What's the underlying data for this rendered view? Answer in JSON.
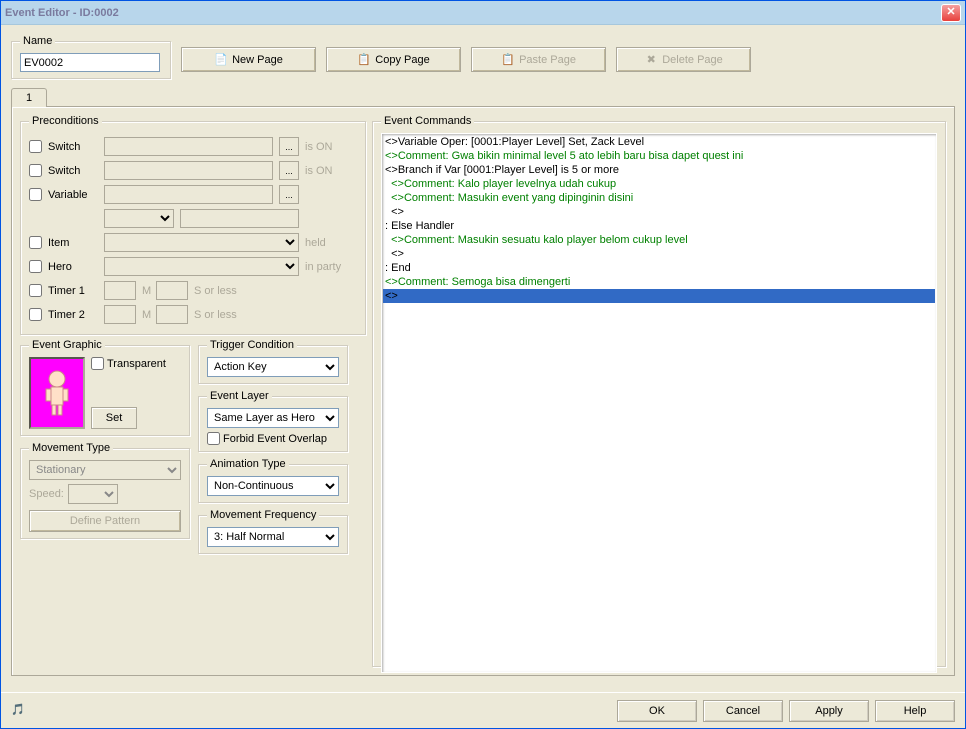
{
  "window": {
    "title": "Event Editor - ID:0002"
  },
  "name": {
    "label": "Name",
    "value": "EV0002"
  },
  "buttons": {
    "new_page": "New Page",
    "copy_page": "Copy Page",
    "paste_page": "Paste Page",
    "delete_page": "Delete Page",
    "ok": "OK",
    "cancel": "Cancel",
    "apply": "Apply",
    "help": "Help",
    "set": "Set"
  },
  "tabs": [
    {
      "label": "1"
    }
  ],
  "preconditions": {
    "legend": "Preconditions",
    "rows": [
      {
        "label": "Switch",
        "suffix": "is ON"
      },
      {
        "label": "Switch",
        "suffix": "is ON"
      },
      {
        "label": "Variable",
        "suffix": ""
      },
      {
        "label": "Item",
        "suffix": "held"
      },
      {
        "label": "Hero",
        "suffix": "in party"
      },
      {
        "label": "Timer 1",
        "suffix": "S or less"
      },
      {
        "label": "Timer 2",
        "suffix": "S or less"
      }
    ]
  },
  "event_graphic": {
    "legend": "Event Graphic",
    "transparent_label": "Transparent"
  },
  "trigger": {
    "legend": "Trigger Condition",
    "value": "Action Key"
  },
  "layer": {
    "legend": "Event Layer",
    "value": "Same Layer as Hero",
    "forbid_label": "Forbid Event Overlap"
  },
  "movement": {
    "legend": "Movement Type",
    "value": "Stationary",
    "speed_label": "Speed:",
    "define_label": "Define Pattern"
  },
  "animation": {
    "legend": "Animation Type",
    "value": "Non-Continuous"
  },
  "frequency": {
    "legend": "Movement Frequency",
    "value": "3: Half Normal"
  },
  "commands": {
    "legend": "Event Commands",
    "lines": [
      {
        "indent": 0,
        "color": "black",
        "text": "<>Variable Oper: [0001:Player Level] Set, Zack Level"
      },
      {
        "indent": 0,
        "color": "green",
        "text": "<>Comment: Gwa bikin minimal level 5 ato lebih baru bisa dapet quest ini"
      },
      {
        "indent": 0,
        "color": "black",
        "text": "<>Branch if Var [0001:Player Level] is 5 or more"
      },
      {
        "indent": 1,
        "color": "green",
        "text": "<>Comment: Kalo player levelnya udah cukup"
      },
      {
        "indent": 1,
        "color": "green",
        "text": "<>Comment: Masukin event yang dipinginin disini"
      },
      {
        "indent": 1,
        "color": "black",
        "text": "<>"
      },
      {
        "indent": 0,
        "color": "black",
        "text": ": Else Handler"
      },
      {
        "indent": 1,
        "color": "green",
        "text": "<>Comment: Masukin sesuatu kalo player belom cukup level"
      },
      {
        "indent": 1,
        "color": "black",
        "text": "<>"
      },
      {
        "indent": 0,
        "color": "black",
        "text": ": End"
      },
      {
        "indent": 0,
        "color": "green",
        "text": "<>Comment: Semoga bisa dimengerti"
      },
      {
        "indent": 0,
        "color": "black",
        "text": "<>",
        "selected": true
      }
    ]
  }
}
